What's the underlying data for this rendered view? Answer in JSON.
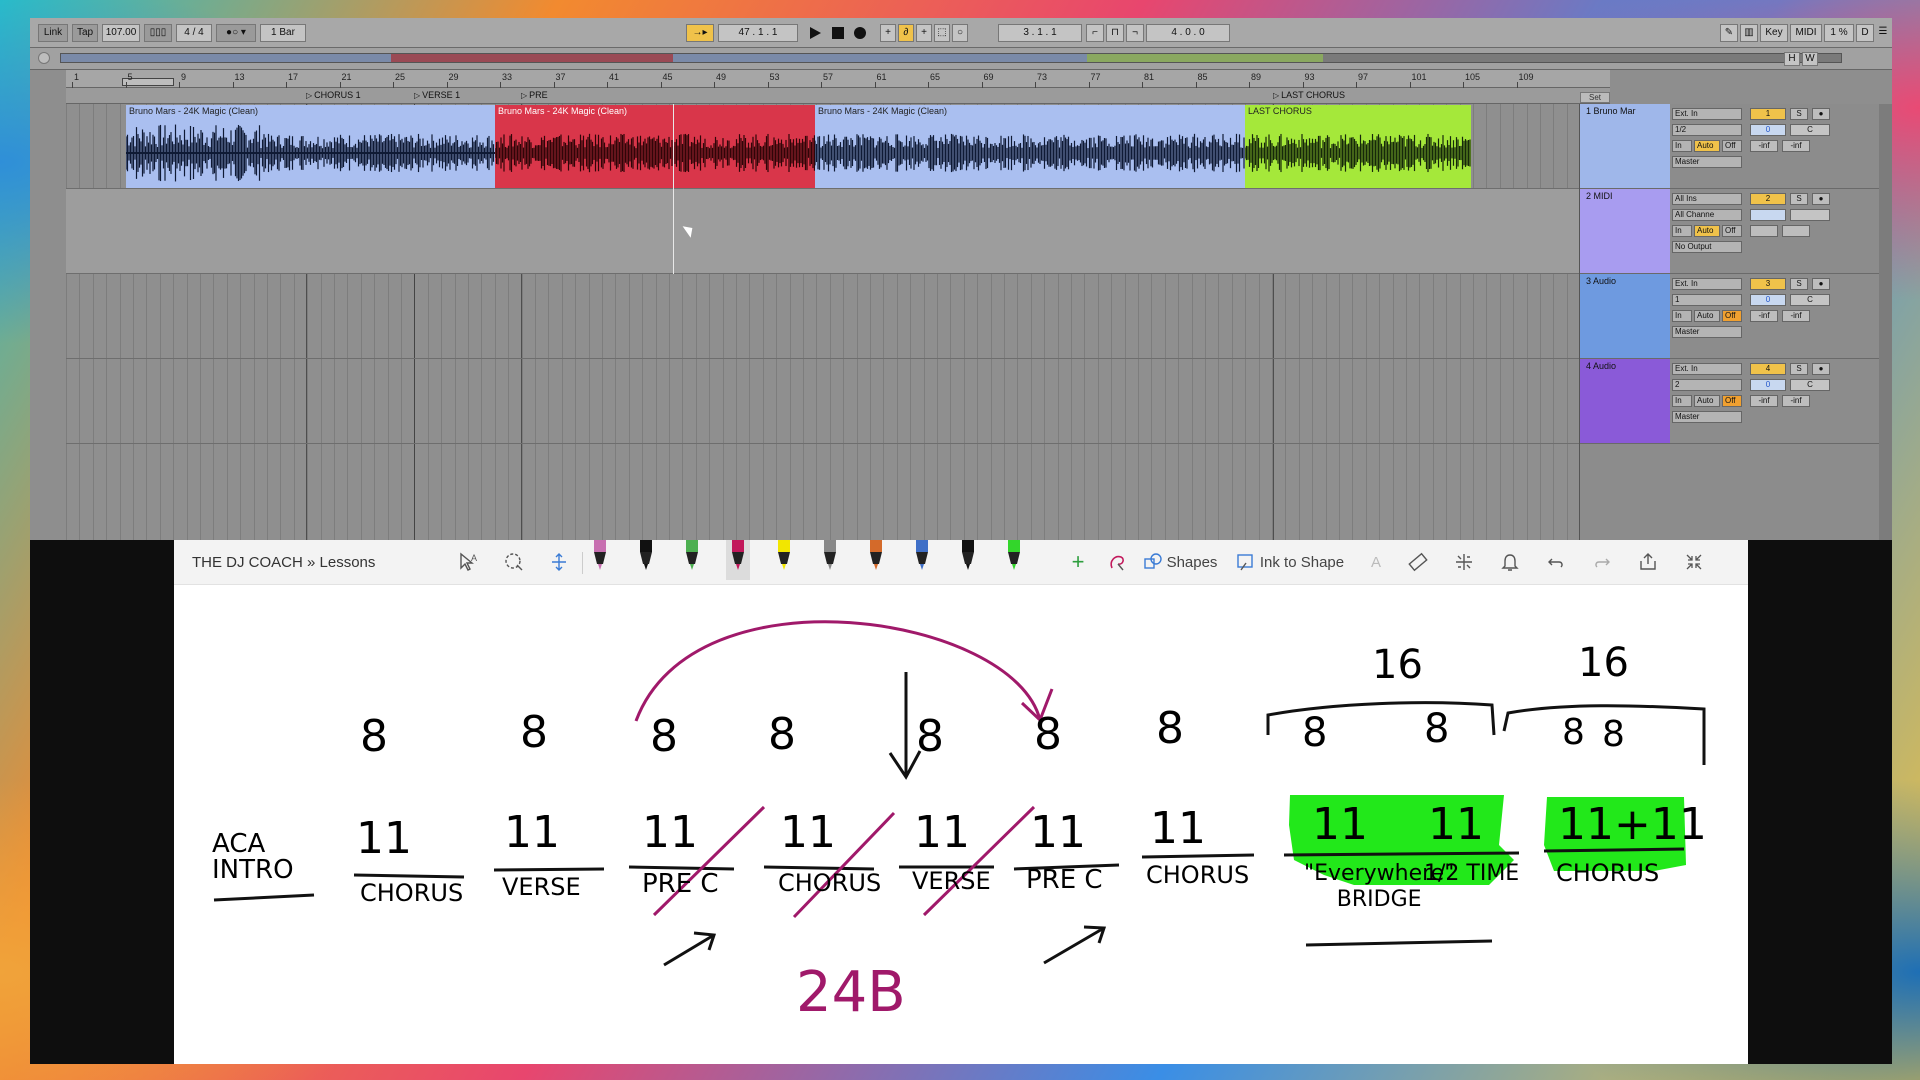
{
  "transport": {
    "link": "Link",
    "tap": "Tap",
    "tempo": "107.00",
    "signature": "4 / 4",
    "quantize": "1 Bar",
    "position": "47 .   1 .   1",
    "loop_start": "3 .   1 .   1",
    "loop_length": "4 .   0 .   0",
    "key": "Key",
    "midi": "MIDI",
    "cpu": "1 %",
    "d": "D"
  },
  "ruler": {
    "bars": [
      "1",
      "5",
      "9",
      "13",
      "17",
      "21",
      "25",
      "29",
      "33",
      "37",
      "41",
      "45",
      "49",
      "53",
      "57",
      "61",
      "65",
      "69",
      "73",
      "77",
      "81",
      "85",
      "89",
      "93",
      "97",
      "101",
      "105",
      "109"
    ]
  },
  "locators": [
    {
      "label": "CHORUS 1"
    },
    {
      "label": "VERSE 1"
    },
    {
      "label": "PRE"
    },
    {
      "label": "LAST CHORUS"
    }
  ],
  "clips": [
    {
      "title": "Bruno Mars - 24K Magic (Clean)",
      "color": "#aabff0",
      "wave": "#0f1a35"
    },
    {
      "title": "Bruno Mars - 24K Magic (Clean)",
      "color": "#d9364a",
      "wave": "#300508"
    },
    {
      "title": "Bruno Mars - 24K Magic (Clean)",
      "color": "#aabff0",
      "wave": "#0f1a35"
    },
    {
      "title": "LAST CHORUS",
      "color": "#a5e83a",
      "wave": "#16280a"
    }
  ],
  "set_label": "Set",
  "tracks": [
    {
      "name": "1 Bruno Mar",
      "color": "#9fb7ea",
      "in_type": "Ext. In",
      "in_chan": "1/2",
      "out": "Master",
      "number": "1",
      "volume": "0",
      "pan": "C",
      "inf1": "-inf",
      "inf2": "-inf",
      "monitor_in": "In",
      "monitor_auto": "Auto",
      "monitor_off": "Off"
    },
    {
      "name": "2 MIDI",
      "color": "#a89cf0",
      "in_type": "All Ins",
      "in_chan": "All Channe",
      "out": "No Output",
      "number": "2",
      "volume": "",
      "pan": "",
      "inf1": "",
      "inf2": "",
      "monitor_in": "In",
      "monitor_auto": "Auto",
      "monitor_off": "Off"
    },
    {
      "name": "3 Audio",
      "color": "#6e9ae0",
      "in_type": "Ext. In",
      "in_chan": "1",
      "out": "Master",
      "number": "3",
      "volume": "0",
      "pan": "C",
      "inf1": "-inf",
      "inf2": "-inf",
      "monitor_in": "In",
      "monitor_auto": "Auto",
      "monitor_off": "Off"
    },
    {
      "name": "4 Audio",
      "color": "#8a5ad8",
      "in_type": "Ext. In",
      "in_chan": "2",
      "out": "Master",
      "number": "4",
      "volume": "0",
      "pan": "C",
      "inf1": "-inf",
      "inf2": "-inf",
      "monitor_in": "In",
      "monitor_auto": "Auto",
      "monitor_off": "Off"
    }
  ],
  "track_buttons": {
    "solo": "S"
  },
  "onenote": {
    "breadcrumb": "THE DJ COACH » Lessons",
    "shapes": "Shapes",
    "ink_to_shape": "Ink to Shape",
    "pen_colors": [
      "#c76fb0",
      "#111111",
      "#4caf50",
      "#c2185b",
      "#f2e600",
      "#888888",
      "#d46a2a",
      "#3f6fc7",
      "#111111",
      "#33d62b"
    ]
  },
  "notes": {
    "intro": "ACA\nINTRO",
    "counts": [
      "8",
      "8",
      "8",
      "8",
      "8",
      "8",
      "8",
      "8",
      "8",
      "8",
      "8"
    ],
    "tallies": [
      "11",
      "11",
      "11",
      "11",
      "11",
      "11",
      "11",
      "11",
      "11",
      "11+11"
    ],
    "sections": [
      "CHORUS",
      "VERSE",
      "PRE C",
      "CHORUS",
      "VERSE",
      "PRE C",
      "CHORUS",
      "\"Everywhere\"\nBRIDGE",
      "1/2 TIME",
      "CHORUS"
    ],
    "group_counts": [
      "16",
      "16"
    ],
    "footnote": "24B",
    "ink_colors": {
      "black": "#111111",
      "magenta": "#a0196a",
      "highlight": "#22e81a"
    }
  }
}
